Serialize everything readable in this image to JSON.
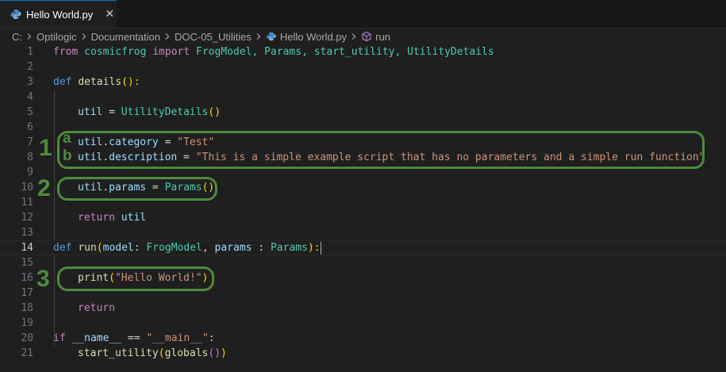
{
  "tab": {
    "label": "Hello World.py",
    "close_glyph": "✕"
  },
  "breadcrumb": {
    "items": [
      "C:",
      "Optilogic",
      "Documentation",
      "DOC-05_Utilities",
      "Hello World.py",
      "run"
    ]
  },
  "editor": {
    "line_numbers": [
      "1",
      "2",
      "3",
      "4",
      "5",
      "6",
      "7",
      "8",
      "9",
      "10",
      "11",
      "12",
      "13",
      "14",
      "15",
      "16",
      "17",
      "18",
      "19",
      "20",
      "21"
    ],
    "current_line": "14",
    "code": {
      "l1": [
        "from",
        " cosmicfrog ",
        "import",
        " FrogModel, Params, start_utility, UtilityDetails"
      ],
      "l3": [
        "def",
        " ",
        "details",
        "():"
      ],
      "l5": [
        "util",
        " = ",
        "UtilityDetails",
        "()"
      ],
      "l7": [
        "util",
        ".",
        "category",
        " = ",
        "\"Test\""
      ],
      "l8": [
        "util",
        ".",
        "description",
        " = ",
        "\"This is a simple example script that has no parameters and a simple run function\""
      ],
      "l10": [
        "util",
        ".",
        "params",
        " = ",
        "Params",
        "()"
      ],
      "l12": [
        "return",
        " ",
        "util"
      ],
      "l14": [
        "def",
        " ",
        "run",
        "(",
        "model",
        ": ",
        "FrogModel",
        ", ",
        "params",
        " : ",
        "Params",
        "):"
      ],
      "l16": [
        "print",
        "(",
        "\"Hello World!\"",
        ")"
      ],
      "l18": [
        "return"
      ],
      "l20": [
        "if",
        " ",
        "__name__",
        " == ",
        "\"__main__\"",
        ":"
      ],
      "l21": [
        "start_utility",
        "(",
        "globals",
        "()",
        ")"
      ]
    }
  },
  "annotations": {
    "n1": "1",
    "n2": "2",
    "n3": "3",
    "a": "a",
    "b": "b",
    "color": "#4f8a3d"
  },
  "colors": {
    "keyword": "#569cd6",
    "control": "#c586c0",
    "type": "#4ec9b0",
    "function": "#dcdcaa",
    "variable": "#9cdcfe",
    "string": "#ce9178"
  }
}
